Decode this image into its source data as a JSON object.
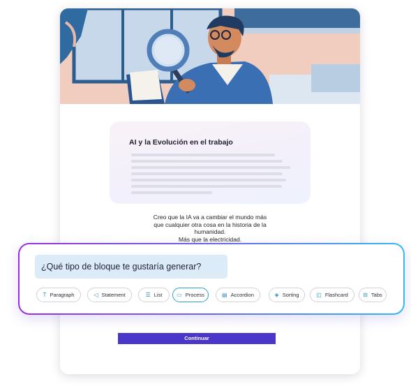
{
  "hero": {
    "image": "illustration-man-with-magnifying-glass"
  },
  "preview": {
    "title": "AI y la Evolución en el trabajo"
  },
  "quote": [
    "Creo que la IA va a cambiar el mundo más",
    "que cualquier otra cosa en la historia de la",
    "humanidad.",
    "Más que la electricidad."
  ],
  "prompt": {
    "question": "¿Qué tipo de bloque te gustaría generar?"
  },
  "chips": [
    {
      "label": "Paragraph",
      "icon": "text-icon",
      "glyph": "T"
    },
    {
      "label": "Statement",
      "icon": "megaphone-icon",
      "glyph": "◁"
    },
    {
      "label": "List",
      "icon": "list-icon",
      "glyph": "☰"
    },
    {
      "label": "Process",
      "icon": "process-icon",
      "glyph": "▭"
    },
    {
      "label": "Accordion",
      "icon": "accordion-icon",
      "glyph": "▤"
    },
    {
      "label": "Sorting",
      "icon": "layers-icon",
      "glyph": "◈"
    },
    {
      "label": "Flashcard",
      "icon": "flashcard-icon",
      "glyph": "◰"
    },
    {
      "label": "Tabs",
      "icon": "tabs-icon",
      "glyph": "⊟"
    }
  ],
  "active_chip": "Process",
  "continue_label": "Continuar",
  "colors": {
    "accent": "#4a37c9",
    "gradient_start": "#9b2fe0",
    "gradient_end": "#35b9f0",
    "active_border": "#2aa4cf"
  }
}
